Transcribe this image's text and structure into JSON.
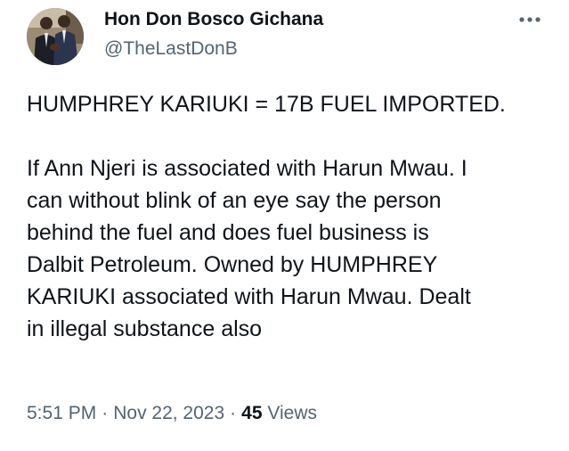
{
  "author": {
    "name": "Hon Don Bosco Gichana",
    "handle": "@TheLastDonB"
  },
  "tweet": {
    "headline": "HUMPHREY KARIUKI = 17B FUEL IMPORTED.",
    "body_lines": [
      "If Ann Njeri is associated with Harun Mwau. I",
      "can without blink of an eye say the person",
      "behind the fuel and does fuel business is",
      "Dalbit Petroleum. Owned by HUMPHREY",
      "KARIUKI associated with Harun Mwau. Dealt",
      "in illegal substance also"
    ]
  },
  "meta": {
    "time": "5:51 PM",
    "separator": "·",
    "date": "Nov 22, 2023",
    "views_count": "45",
    "views_label": "Views"
  },
  "icons": {
    "more": "more-dots-icon",
    "avatar": "profile-photo"
  },
  "colors": {
    "text_primary": "#0f1419",
    "text_secondary": "#536471",
    "background": "#ffffff"
  }
}
